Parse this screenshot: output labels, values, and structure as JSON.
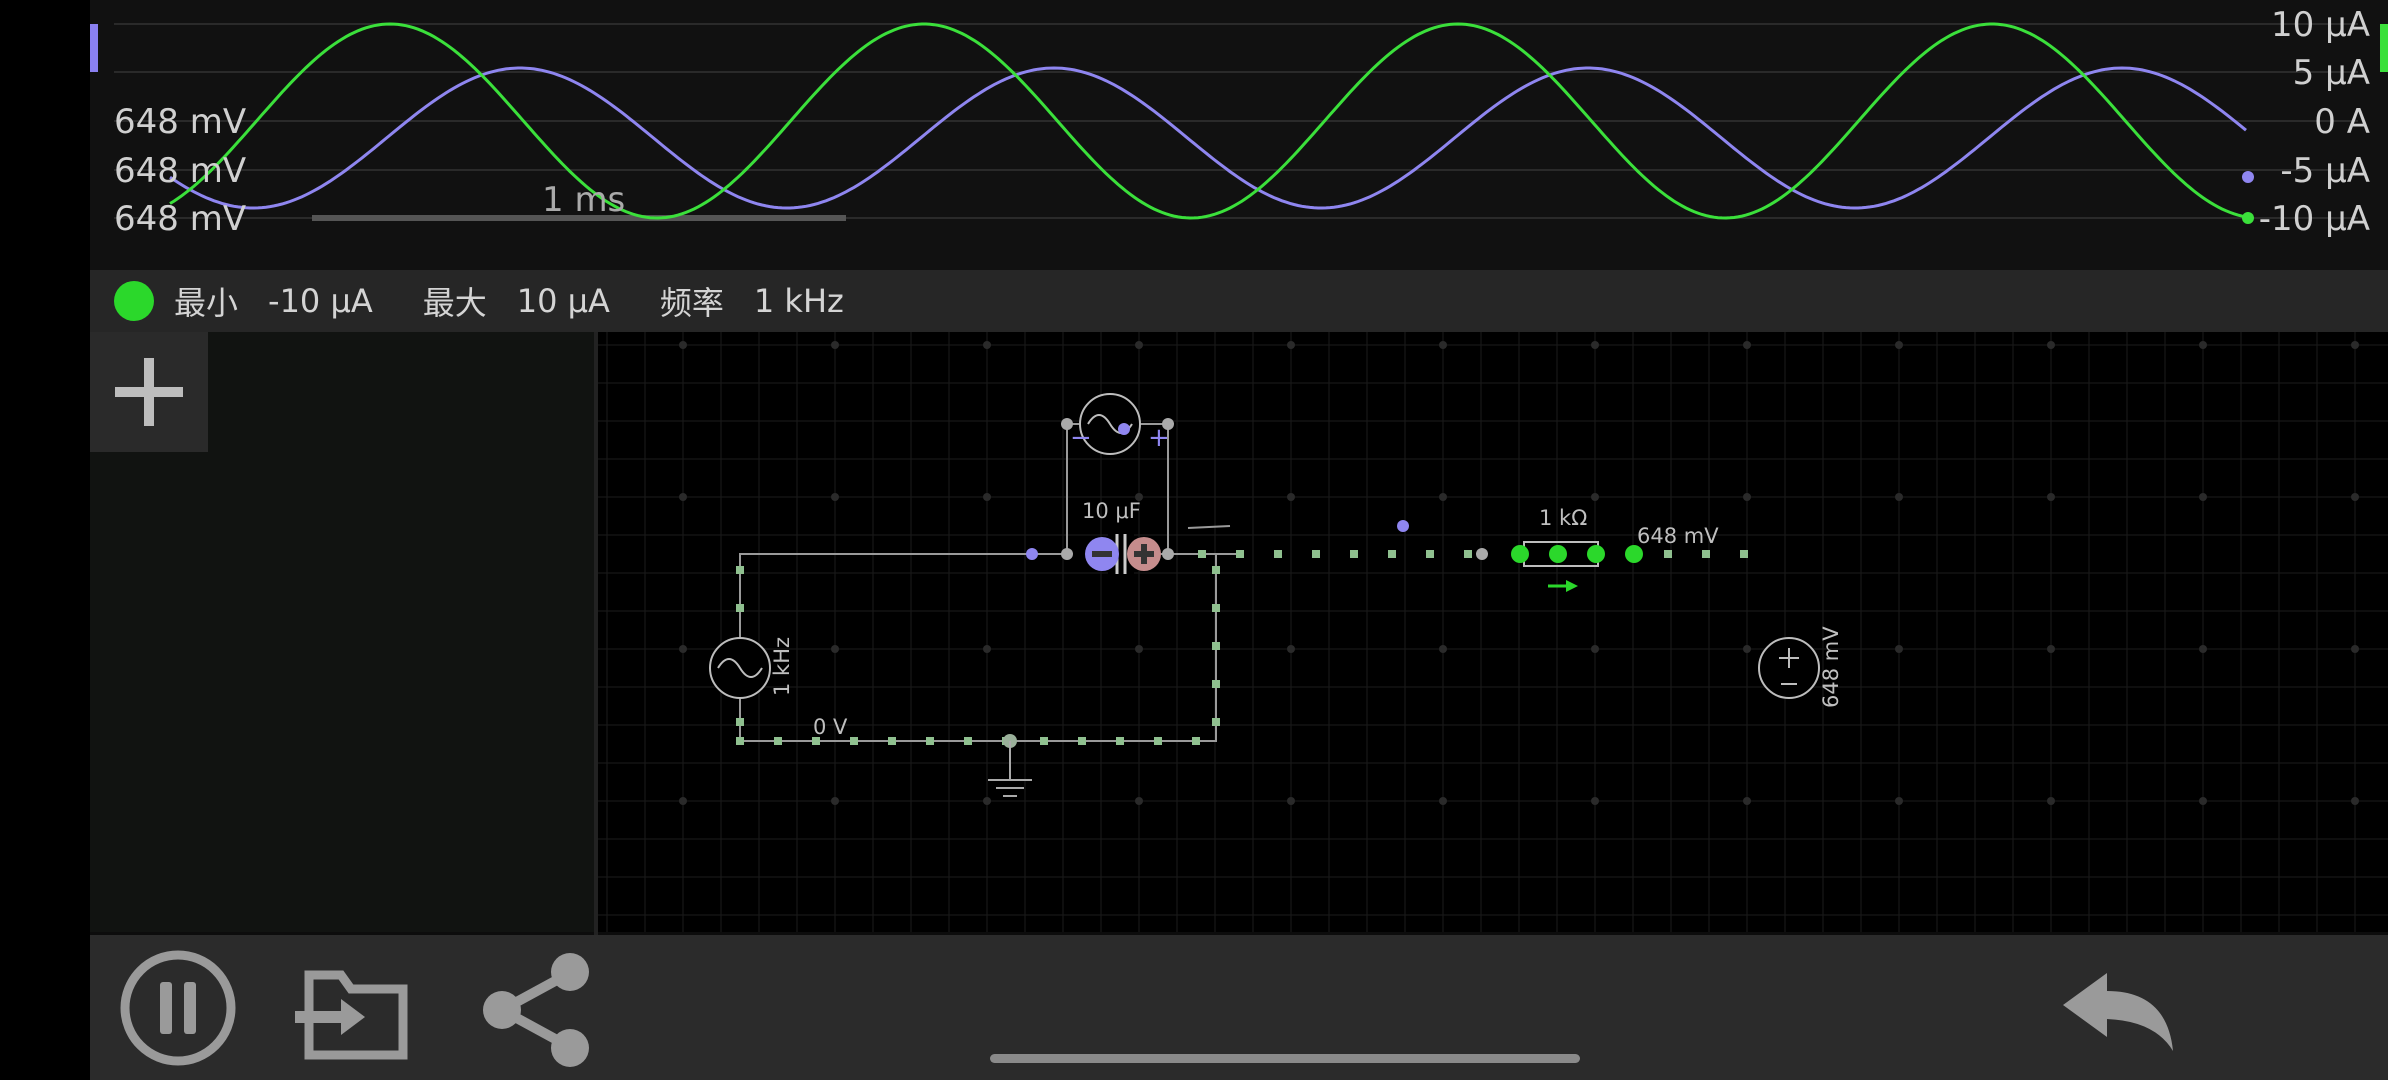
{
  "scope": {
    "left_labels": [
      "648 mV",
      "648 mV",
      "648 mV"
    ],
    "right_labels": [
      "10 μA",
      "5 μA",
      "0 A",
      "-5 μA",
      "-10 μA"
    ],
    "timebase_label": "1 ms",
    "colors": {
      "current_trace": "#3be03b",
      "voltage_trace": "#8f86f0",
      "grid": "#2a2a2a"
    }
  },
  "info_bar": {
    "min_label": "最小",
    "min_value": "-10 μA",
    "max_label": "最大",
    "max_value": "10 μA",
    "freq_label": "频率",
    "freq_value": "1 kHz",
    "indicator_color": "#2bd82b"
  },
  "circuit": {
    "source_freq": "1 kHz",
    "capacitor": "10 μF",
    "resistor": "1 kΩ",
    "probe_voltage": "648 mV",
    "dc_source_voltage": "648 mV",
    "ground_voltage": "0 V",
    "top_minus": "−",
    "top_plus": "+"
  },
  "toolbar": {
    "buttons": [
      "pause-icon",
      "import-folder-icon",
      "share-icon",
      "undo-icon"
    ]
  }
}
